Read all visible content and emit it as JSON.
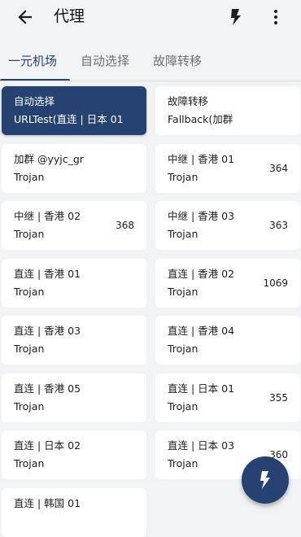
{
  "header": {
    "title": "代理",
    "back_icon": "arrow-back-icon",
    "test_icon": "lightning-bolt-icon",
    "more_icon": "more-vert-icon"
  },
  "tabs": [
    {
      "label": "一元机场",
      "active": true
    },
    {
      "label": "自动选择",
      "active": false
    },
    {
      "label": "故障转移",
      "active": false
    }
  ],
  "colors": {
    "accent": "#254272",
    "background": "#f2f3f5",
    "card": "#ffffff"
  },
  "proxies": [
    {
      "name": "自动选择",
      "type": "URLTest(直连 | 日本 01",
      "latency": "",
      "selected": true
    },
    {
      "name": "故障转移",
      "type": "Fallback(加群",
      "latency": "",
      "selected": false
    },
    {
      "name": "加群 @yyjc_gr",
      "type": "Trojan",
      "latency": "",
      "selected": false
    },
    {
      "name": "中继 | 香港 01",
      "type": "Trojan",
      "latency": "364",
      "selected": false
    },
    {
      "name": "中继 | 香港 02",
      "type": "Trojan",
      "latency": "368",
      "selected": false
    },
    {
      "name": "中继 | 香港 03",
      "type": "Trojan",
      "latency": "363",
      "selected": false
    },
    {
      "name": "直连 | 香港 01",
      "type": "Trojan",
      "latency": "",
      "selected": false
    },
    {
      "name": "直连 | 香港 02",
      "type": "Trojan",
      "latency": "1069",
      "selected": false
    },
    {
      "name": "直连 | 香港 03",
      "type": "Trojan",
      "latency": "",
      "selected": false
    },
    {
      "name": "直连 | 香港 04",
      "type": "Trojan",
      "latency": "",
      "selected": false
    },
    {
      "name": "直连 | 香港 05",
      "type": "Trojan",
      "latency": "",
      "selected": false
    },
    {
      "name": "直连 | 日本 01",
      "type": "Trojan",
      "latency": "355",
      "selected": false
    },
    {
      "name": "直连 | 日本 02",
      "type": "Trojan",
      "latency": "",
      "selected": false
    },
    {
      "name": "直连 | 日本 03",
      "type": "Trojan",
      "latency": "360",
      "selected": false
    },
    {
      "name": "直连 |  韩国 01",
      "type": "",
      "latency": "",
      "selected": false
    }
  ],
  "fab": {
    "icon": "lightning-bolt-icon"
  }
}
